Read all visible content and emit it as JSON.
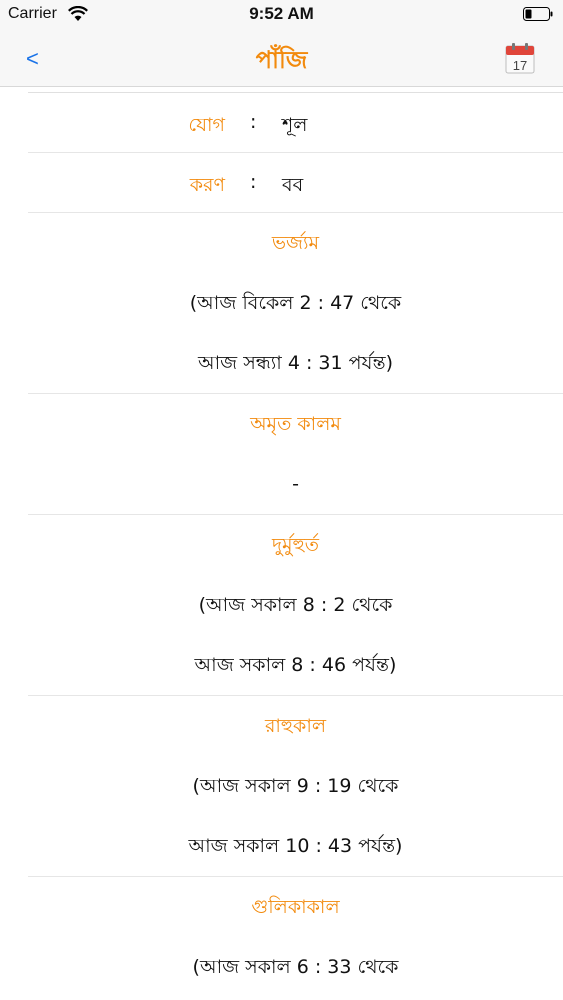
{
  "status_bar": {
    "carrier": "Carrier",
    "time": "9:52 AM"
  },
  "nav": {
    "back": "<",
    "title": "পাঁজি",
    "calendar_day": "17"
  },
  "rows": [
    {
      "key": "যোগ",
      "colon": ":",
      "value": "শূল"
    },
    {
      "key": "করণ",
      "colon": ":",
      "value": "বব"
    }
  ],
  "sections": [
    {
      "title": "ভর্জ্যম",
      "line1": "(আজ বিকেল 2 : 47   থেকে",
      "line2": "আজ সন্ধ্যা 4 : 31   পর্যন্ত)"
    },
    {
      "title": "অমৃত কালম",
      "line1": "-"
    },
    {
      "title": "দুর্মুহুর্ত",
      "line1": "(আজ সকাল 8 : 2   থেকে",
      "line2": "আজ সকাল 8 : 46   পর্যন্ত)"
    },
    {
      "title": "রাহুকাল",
      "line1": "(আজ সকাল 9 : 19   থেকে",
      "line2": "আজ সকাল 10 : 43   পর্যন্ত)"
    },
    {
      "title": "গুলিকাকাল",
      "line1": "(আজ সকাল 6 : 33   থেকে"
    }
  ]
}
